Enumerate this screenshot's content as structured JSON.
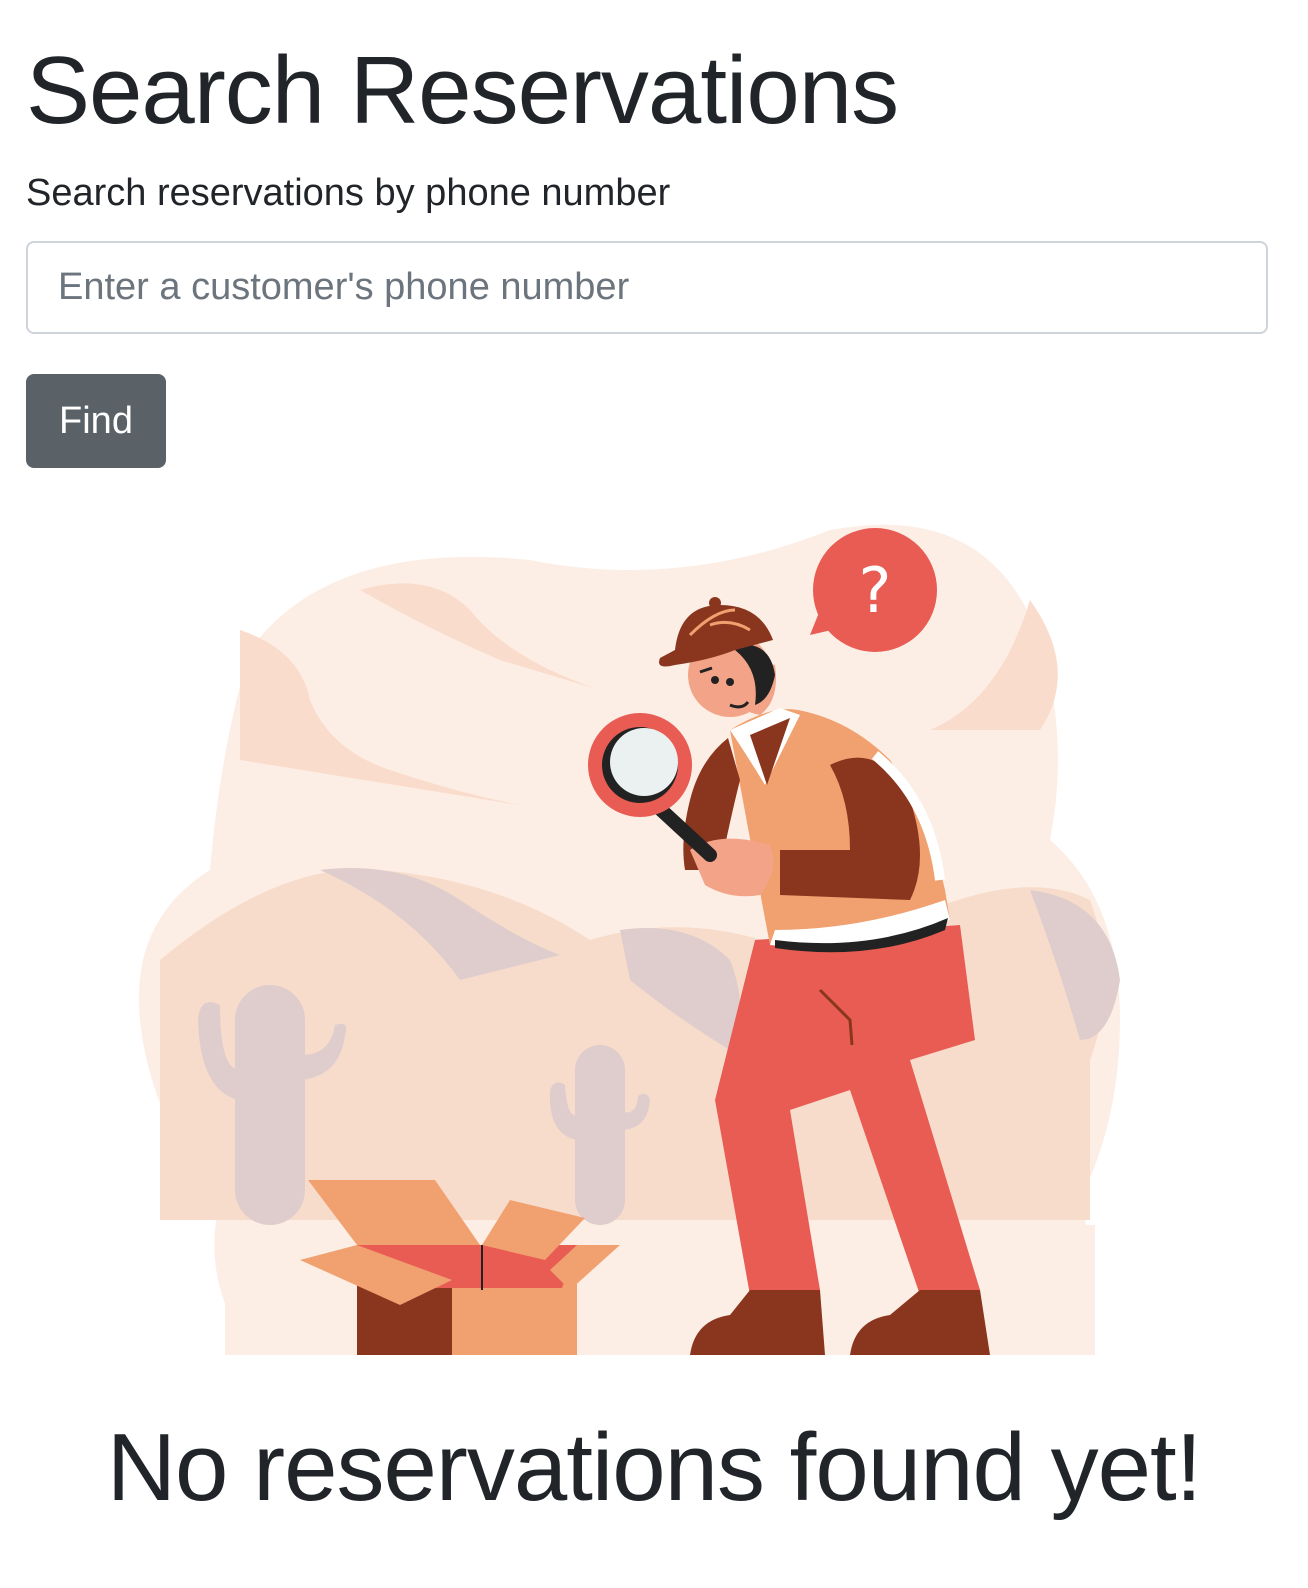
{
  "page": {
    "title": "Search Reservations"
  },
  "search": {
    "label": "Search reservations by phone number",
    "placeholder": "Enter a customer's phone number",
    "value": "",
    "button_label": "Find"
  },
  "illustration": {
    "subject": "detective-with-magnifying-glass",
    "speech_bubble_text": "?"
  },
  "results": {
    "empty_message": "No reservations found yet!"
  },
  "colors": {
    "text": "#212529",
    "button_bg": "#5a6268",
    "input_border": "#ced4da",
    "accent_red": "#e85c53",
    "brown": "#8a361f",
    "orange": "#f0a16f",
    "background_peach": "#fdeee5"
  }
}
